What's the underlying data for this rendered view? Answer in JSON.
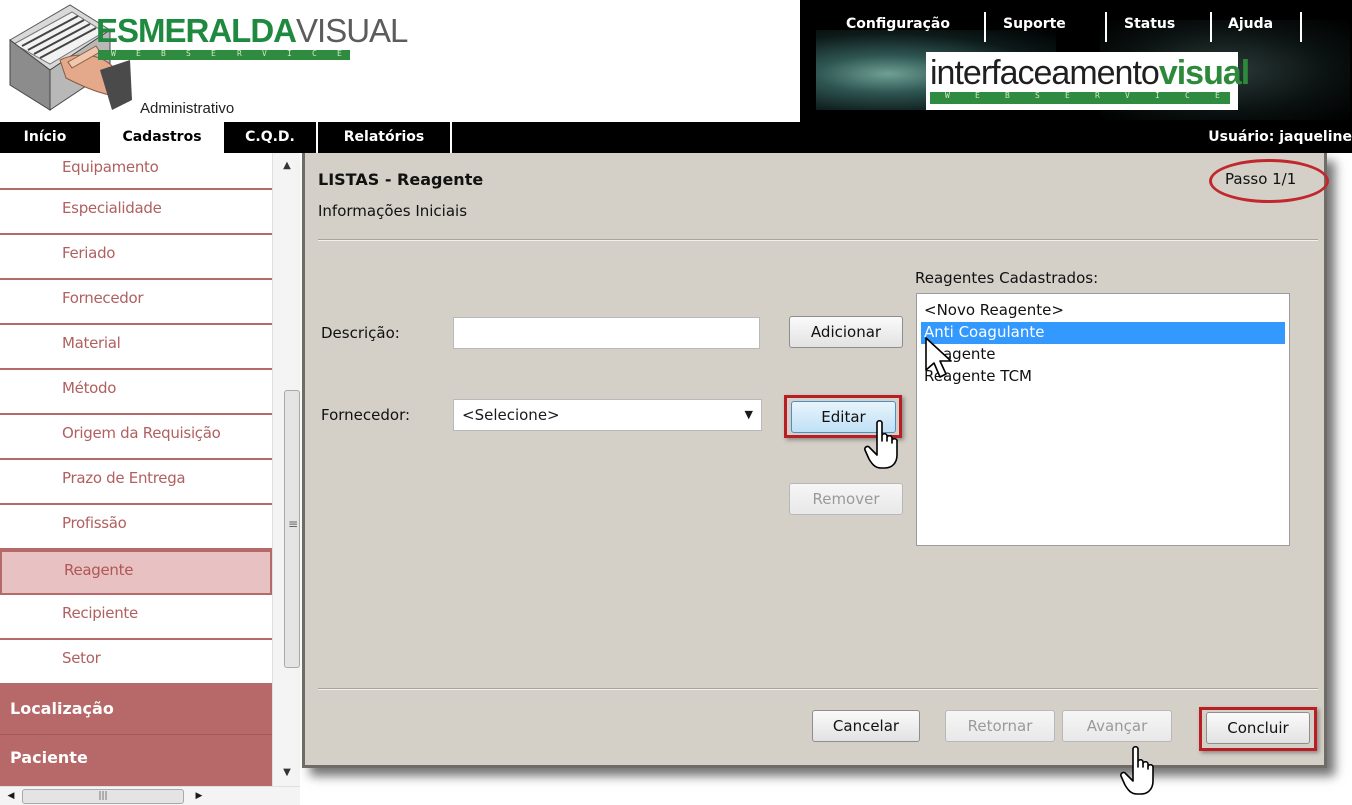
{
  "header": {
    "brand_part1": "ESMERALDA",
    "brand_part2": "VISUAL",
    "brand_tagline": "W E B S E R V I C E",
    "area_label": "Administrativo",
    "partner_logo_part1": "interfaceamento",
    "partner_logo_part2": "visual",
    "partner_tagline": "W E B S E R V I C E",
    "top_links": [
      "Configuração",
      "Suporte",
      "Status",
      "Ajuda"
    ]
  },
  "menu": {
    "items": [
      {
        "label": "Início",
        "active": false
      },
      {
        "label": "Cadastros",
        "active": true
      },
      {
        "label": "C.Q.D.",
        "active": false
      },
      {
        "label": "Relatórios",
        "active": false
      }
    ],
    "user": "Usuário: jaqueline"
  },
  "sidebar": {
    "items": [
      "Equipamento",
      "Especialidade",
      "Feriado",
      "Fornecedor",
      "Material",
      "Método",
      "Origem da Requisição",
      "Prazo de Entrega",
      "Profissão",
      "Reagente",
      "Recipiente",
      "Setor"
    ],
    "selected": "Reagente",
    "groups": [
      "Localização",
      "Paciente"
    ]
  },
  "dialog": {
    "title": "LISTAS - Reagente",
    "subtitle": "Informações Iniciais",
    "step": "Passo 1/1",
    "description_label": "Descrição:",
    "description_value": "",
    "supplier_label": "Fornecedor:",
    "supplier_value": "<Selecione>",
    "buttons": {
      "add": "Adicionar",
      "edit": "Editar",
      "remove": "Remover",
      "cancel": "Cancelar",
      "back": "Retornar",
      "next": "Avançar",
      "finish": "Concluir"
    },
    "list_label": "Reagentes Cadastrados:",
    "list_items": [
      "<Novo Reagente>",
      "Anti Coagulante",
      "Reagente",
      "Reagente TCM"
    ],
    "list_selected": "Anti Coagulante"
  },
  "colors": {
    "sidebar_text": "#b06060",
    "sidebar_group_bg": "#b76868",
    "highlight_red": "#b71f25",
    "list_selection": "#3399ff",
    "panel_bg": "#d4d0c8"
  }
}
